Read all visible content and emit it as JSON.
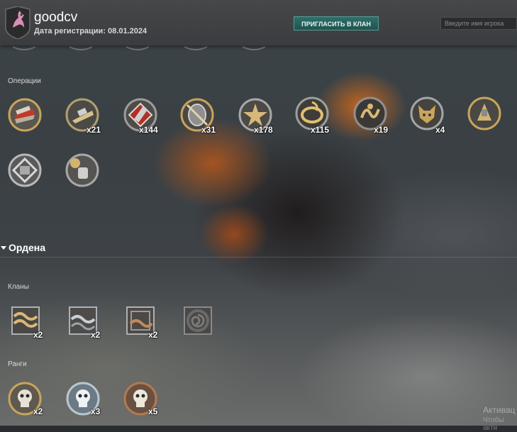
{
  "header": {
    "username": "goodcv",
    "registration": "Дата регистрации: 08.01.2024",
    "invite_button": "ПРИГЛАСИТЬ В КЛАН",
    "search_placeholder": "Введите имя игрока"
  },
  "sections": {
    "operations": {
      "label": "Операции",
      "items": [
        {
          "icon": "red-ship-emblem-icon",
          "count": ""
        },
        {
          "icon": "gold-battleship-emblem-icon",
          "count": "x21"
        },
        {
          "icon": "red-gun-emblem-icon",
          "count": "x144"
        },
        {
          "icon": "shield-sword-emblem-icon",
          "count": "x31"
        },
        {
          "icon": "star-emblem-icon",
          "count": "x178"
        },
        {
          "icon": "gold-ring-emblem-icon",
          "count": "x115"
        },
        {
          "icon": "serpent-emblem-icon",
          "count": "x19"
        },
        {
          "icon": "fox-emblem-icon",
          "count": "x4"
        },
        {
          "icon": "gold-warrior-emblem-icon",
          "count": ""
        },
        {
          "icon": "silver-fortress-emblem-icon",
          "count": ""
        },
        {
          "icon": "fist-emblem-icon",
          "count": ""
        }
      ]
    },
    "orders": {
      "title": "Ордена"
    },
    "clans": {
      "label": "Кланы",
      "items": [
        {
          "icon": "gold-wave-clan-icon",
          "count": "x2"
        },
        {
          "icon": "silver-wave-clan-icon",
          "count": "x2"
        },
        {
          "icon": "bronze-wave-clan-icon",
          "count": "x2"
        },
        {
          "icon": "spiral-clan-icon",
          "count": ""
        }
      ]
    },
    "ranks": {
      "label": "Ранги",
      "items": [
        {
          "icon": "gold-skull-rank-icon",
          "count": "x2"
        },
        {
          "icon": "silver-skull-rank-icon",
          "count": "x3"
        },
        {
          "icon": "bronze-skull-rank-icon",
          "count": "x5"
        }
      ]
    }
  },
  "watermark": {
    "line1": "Активац",
    "line2": "Чтобы акти"
  },
  "colors": {
    "invite_button": "#2f6f6a",
    "gold": "#c9a45a",
    "silver": "#a9b2b8",
    "bronze": "#b07a52",
    "red": "#c0392b"
  }
}
